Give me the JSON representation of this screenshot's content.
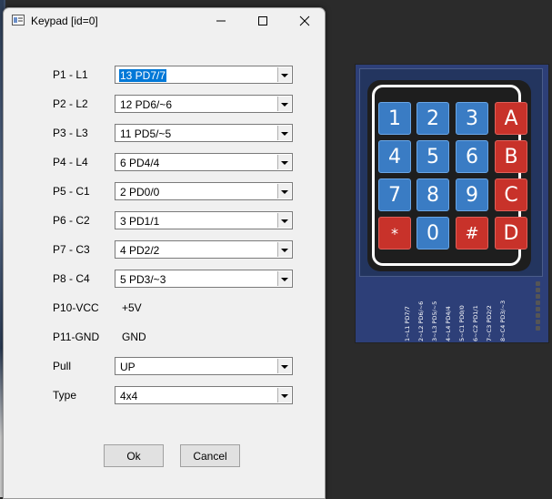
{
  "window": {
    "title": "Keypad [id=0]"
  },
  "form": {
    "rows": [
      {
        "label": "P1 - L1",
        "value": "13  PD7/7",
        "selected": true
      },
      {
        "label": "P2 - L2",
        "value": "12  PD6/~6"
      },
      {
        "label": "P3 - L3",
        "value": "11  PD5/~5"
      },
      {
        "label": "P4 - L4",
        "value": "6  PD4/4"
      },
      {
        "label": "P5 - C1",
        "value": "2  PD0/0"
      },
      {
        "label": "P6 - C2",
        "value": "3  PD1/1"
      },
      {
        "label": "P7 - C3",
        "value": "4  PD2/2"
      },
      {
        "label": "P8 - C4",
        "value": "5  PD3/~3"
      }
    ],
    "vcc": {
      "label": "P10-VCC",
      "value": "+5V"
    },
    "gnd": {
      "label": "P11-GND",
      "value": "GND"
    },
    "pull": {
      "label": "Pull",
      "value": "UP"
    },
    "type": {
      "label": "Type",
      "value": "4x4"
    }
  },
  "buttons": {
    "ok": "Ok",
    "cancel": "Cancel"
  },
  "keypad": {
    "keys": [
      [
        "1",
        "2",
        "3",
        "A"
      ],
      [
        "4",
        "5",
        "6",
        "B"
      ],
      [
        "7",
        "8",
        "9",
        "C"
      ],
      [
        "*",
        "0",
        "#",
        "D"
      ]
    ],
    "pin_labels": [
      "1~L1 PD7/7",
      "2~L2 PD6/~6",
      "3~L3 PD5/~5",
      "4~L4 PD4/4",
      "5~C1 PD0/0",
      "6~C2 PD1/1",
      "7~C3 PD2/2",
      "8~C4 PD3/~3"
    ],
    "colors": {
      "digit_key": "#3a7cc4",
      "letter_key": "#c8322a",
      "board": "#2d3f78"
    }
  },
  "icons": {
    "app": "window-app-icon",
    "minimize": "minimize-icon",
    "maximize": "maximize-icon",
    "close": "close-icon"
  }
}
